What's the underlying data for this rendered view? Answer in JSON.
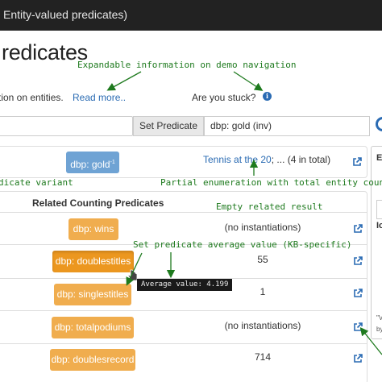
{
  "topbar": {
    "title": "Entity-valued predicates)"
  },
  "page": {
    "title": "redicates"
  },
  "info": {
    "text": "tion on entities.",
    "read_more": "Read more..",
    "stuck": "Are you stuck?",
    "info_icon": "info-icon"
  },
  "search": {
    "input_value": "",
    "set_button": "Set Predicate",
    "predicate_value": "dbp: gold (inv)"
  },
  "main_predicate": {
    "badge_label": "dbp: gold",
    "badge_sup": "-1",
    "enum_link": "Tennis at the 20",
    "enum_rest": "; ... (4 in total)"
  },
  "related": {
    "header": "Related Counting Predicates",
    "rows": [
      {
        "label": "dbp: wins",
        "value": "(no instantiations)"
      },
      {
        "label": "dbp: doublestitles",
        "value": "55"
      },
      {
        "label": "dbp: singlestitles",
        "value": "1"
      },
      {
        "label": "dbp: totalpodiums",
        "value": "(no instantiations)"
      },
      {
        "label": "dbp: doublesrecord",
        "value": "714"
      }
    ],
    "tooltip": "Average value: 4.199"
  },
  "right_panel": {
    "c1": "E",
    "c2": "Ic",
    "c3": "\"V",
    "c4": "by"
  },
  "annotations": {
    "expandable": "Expandable information on demo navigation",
    "predicate_variant": "dicate variant",
    "partial_enum": "Partial enumeration with total entity count",
    "empty_related": "Empty related result",
    "set_avg": "Set predicate average value (KB-specific)"
  },
  "colors": {
    "topbar": "#222222",
    "link": "#2a6bb3",
    "badge_blue": "#6fa3d4",
    "badge_orange": "#f0ad4e",
    "annotation": "#1e7a1e"
  }
}
